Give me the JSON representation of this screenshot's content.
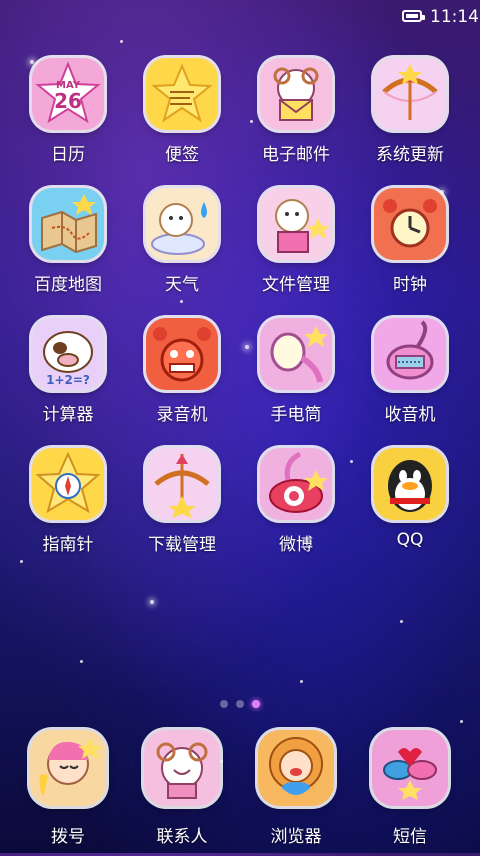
{
  "status_bar": {
    "time": "11:14"
  },
  "apps": [
    {
      "label": "日历",
      "icon": "calendar-icon",
      "month": "MAY",
      "day": "26",
      "color": "#f4a8d8"
    },
    {
      "label": "便签",
      "icon": "notes-icon",
      "color": "#ffd84a"
    },
    {
      "label": "电子邮件",
      "icon": "email-icon",
      "color": "#f7c0e0"
    },
    {
      "label": "系统更新",
      "icon": "system-update-icon",
      "color": "#f5d2f0"
    },
    {
      "label": "百度地图",
      "icon": "map-icon",
      "color": "#7ad0f0"
    },
    {
      "label": "天气",
      "icon": "weather-icon",
      "color": "#fbe8c8"
    },
    {
      "label": "文件管理",
      "icon": "file-manager-icon",
      "color": "#f8d0e8"
    },
    {
      "label": "时钟",
      "icon": "clock-icon",
      "color": "#f07050"
    },
    {
      "label": "计算器",
      "icon": "calculator-icon",
      "color": "#e8d0f8",
      "calc_text": "1+2=?"
    },
    {
      "label": "录音机",
      "icon": "recorder-icon",
      "color": "#f06040"
    },
    {
      "label": "手电筒",
      "icon": "flashlight-icon",
      "color": "#f0b0e0"
    },
    {
      "label": "收音机",
      "icon": "radio-icon",
      "color": "#f0a8e8"
    },
    {
      "label": "指南针",
      "icon": "compass-icon",
      "color": "#ffd84a"
    },
    {
      "label": "下载管理",
      "icon": "download-manager-icon",
      "color": "#f5d2f0"
    },
    {
      "label": "微博",
      "icon": "weibo-icon",
      "color": "#f0b0e0"
    },
    {
      "label": "QQ",
      "icon": "qq-icon",
      "color": "#f8d040"
    }
  ],
  "dock": [
    {
      "label": "拨号",
      "icon": "phone-dialer-icon",
      "color": "#f8d8a0"
    },
    {
      "label": "联系人",
      "icon": "contacts-icon",
      "color": "#f5c0e0"
    },
    {
      "label": "浏览器",
      "icon": "browser-icon",
      "color": "#f8b860"
    },
    {
      "label": "短信",
      "icon": "sms-icon",
      "color": "#f0a0d8"
    }
  ],
  "page_indicator": {
    "pages": 3,
    "active": 3
  }
}
